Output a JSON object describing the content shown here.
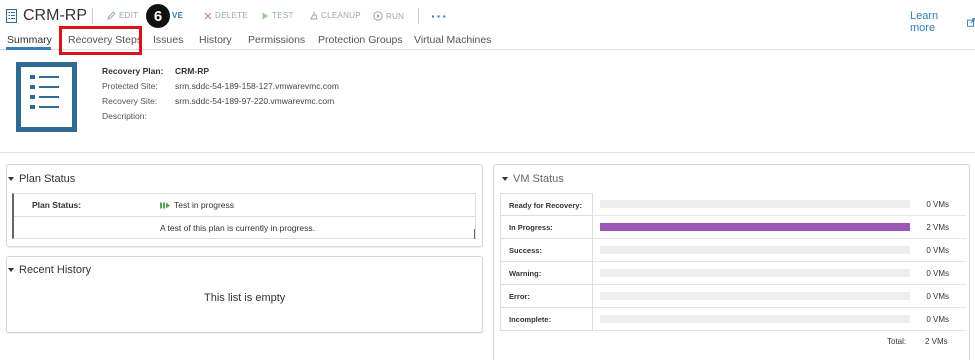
{
  "header": {
    "title": "CRM-RP",
    "toolbar": {
      "edit": "EDIT",
      "move": "VE",
      "delete": "DELETE",
      "test": "TEST",
      "cleanup": "CLEANUP",
      "run": "RUN",
      "more": "···"
    },
    "learn_more": "Learn more",
    "step_badge": "6"
  },
  "tabs": [
    {
      "label": "Summary",
      "active": true
    },
    {
      "label": "Recovery Steps",
      "highlighted": true
    },
    {
      "label": "Issues"
    },
    {
      "label": "History"
    },
    {
      "label": "Permissions"
    },
    {
      "label": "Protection Groups"
    },
    {
      "label": "Virtual Machines"
    }
  ],
  "summary": {
    "recovery_plan_label": "Recovery Plan:",
    "recovery_plan_value": "CRM-RP",
    "protected_site_label": "Protected Site:",
    "protected_site_value": "srm.sddc-54-189-158-127.vmwarevmc.com",
    "recovery_site_label": "Recovery Site:",
    "recovery_site_value": "srm.sddc-54-189-97-220.vmwarevmc.com",
    "description_label": "Description:",
    "description_value": ""
  },
  "plan_status": {
    "title": "Plan Status",
    "label": "Plan Status:",
    "value": "Test in progress",
    "message": "A test of this plan is currently in progress."
  },
  "recent_history": {
    "title": "Recent History",
    "empty_message": "This list is empty"
  },
  "vm_status": {
    "title": "VM Status",
    "rows": [
      {
        "label": "Ready for Recovery:",
        "count": "0 VMs",
        "fraction": 0
      },
      {
        "label": "In Progress:",
        "count": "2 VMs",
        "fraction": 1
      },
      {
        "label": "Success:",
        "count": "0 VMs",
        "fraction": 0
      },
      {
        "label": "Warning:",
        "count": "0 VMs",
        "fraction": 0
      },
      {
        "label": "Error:",
        "count": "0 VMs",
        "fraction": 0
      },
      {
        "label": "Incomplete:",
        "count": "0 VMs",
        "fraction": 0
      }
    ],
    "total_label": "Total:",
    "total_count": "2 VMs"
  },
  "colors": {
    "accent": "#2f7fbf",
    "highlight": "#d9131b",
    "in_progress_bar": "#9a57b8",
    "plan_icon": "#2e6a94"
  }
}
